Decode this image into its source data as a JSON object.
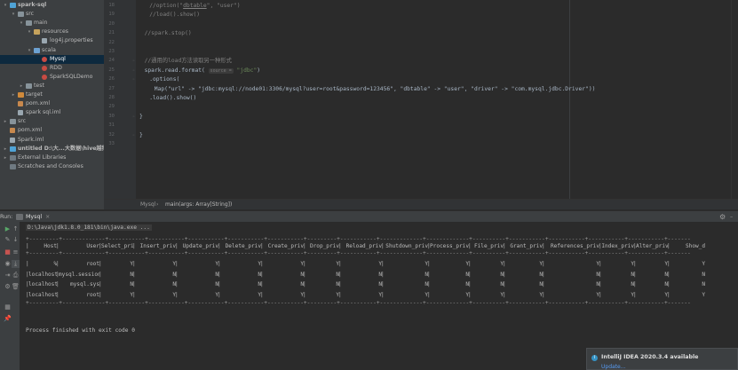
{
  "project_tree": [
    {
      "label": "spark-sql",
      "arrow": "▾",
      "icon": "module-folder-icon",
      "bold": true
    },
    {
      "label": "src",
      "arrow": "▾",
      "icon": "folder-icon"
    },
    {
      "label": "main",
      "arrow": "▾",
      "icon": "folder-icon"
    },
    {
      "label": "resources",
      "arrow": "▾",
      "icon": "resources-folder-icon"
    },
    {
      "label": "log4j.properties",
      "arrow": "",
      "icon": "properties-file-icon"
    },
    {
      "label": "scala",
      "arrow": "▾",
      "icon": "source-folder-icon"
    },
    {
      "label": "Mysql",
      "arrow": "",
      "icon": "scala-object-icon",
      "selected": true
    },
    {
      "label": "RDD",
      "arrow": "",
      "icon": "scala-object-icon"
    },
    {
      "label": "SparkSQLDemo",
      "arrow": "",
      "icon": "scala-object-icon"
    },
    {
      "label": "test",
      "arrow": "▸",
      "icon": "folder-icon"
    },
    {
      "label": "target",
      "arrow": "▸",
      "icon": "target-folder-icon"
    },
    {
      "label": "pom.xml",
      "arrow": "",
      "icon": "maven-file-icon"
    },
    {
      "label": "spark sql.iml",
      "arrow": "",
      "icon": "iml-file-icon"
    },
    {
      "label": "src",
      "arrow": "▸",
      "icon": "folder-icon"
    },
    {
      "label": "pom.xml",
      "arrow": "",
      "icon": "maven-file-icon"
    },
    {
      "label": "Spark.iml",
      "arrow": "",
      "icon": "iml-file-icon"
    },
    {
      "label": "untitled  D:\\大...大数据\\hive越狱书",
      "arrow": "▸",
      "icon": "module-folder-icon",
      "bold": true
    },
    {
      "label": "External Libraries",
      "arrow": "▸",
      "icon": "library-icon"
    },
    {
      "label": "Scratches and Consoles",
      "arrow": "",
      "icon": "scratches-icon"
    }
  ],
  "editor": {
    "line_numbers": [
      "18",
      "19",
      "20",
      "21",
      "22",
      "23",
      "24",
      "25",
      "26",
      "27",
      "28",
      "29",
      "30",
      "31",
      "32",
      "33"
    ],
    "lines": [
      {
        "indent": 2,
        "parts": [
          {
            "c": "cmt",
            "t": "//option(\""
          },
          {
            "c": "cmt",
            "t": "dbtable"
          },
          {
            "c": "cmt",
            "t": "\", \"user\")"
          }
        ]
      },
      {
        "indent": 2,
        "parts": [
          {
            "c": "cmt",
            "t": "//load().show()"
          }
        ]
      },
      {
        "indent": 0,
        "parts": []
      },
      {
        "indent": 1,
        "parts": [
          {
            "c": "cmt",
            "t": "//spark.stop()"
          }
        ]
      },
      {
        "indent": 0,
        "parts": []
      },
      {
        "indent": 0,
        "parts": []
      },
      {
        "indent": 1,
        "parts": [
          {
            "c": "cmt",
            "t": "//通用的load方法读取另一种形式"
          }
        ]
      },
      {
        "indent": 1,
        "parts": [
          {
            "c": "",
            "t": "spark.read.format( "
          },
          {
            "c": "hint",
            "t": "source ="
          },
          {
            "c": "str",
            "t": " \"jdbc\""
          },
          {
            "c": "",
            "t": ")"
          }
        ]
      },
      {
        "indent": 2,
        "parts": [
          {
            "c": "",
            "t": ".options("
          }
        ]
      },
      {
        "indent": 3,
        "parts": [
          {
            "c": "",
            "t": "Map(\"url\" -> \"jdbc:mysql://node01:3306/mysql?user=root&password=123456\", \"dbtable\" -> \"user\", \"driver\" -> \"com.mysql.jdbc.Driver\"))"
          }
        ]
      },
      {
        "indent": 2,
        "parts": [
          {
            "c": "",
            "t": ".load().show()"
          }
        ]
      },
      {
        "indent": 0,
        "parts": []
      },
      {
        "indent": 0,
        "parts": [
          {
            "c": "",
            "t": "}"
          }
        ]
      },
      {
        "indent": 0,
        "parts": []
      },
      {
        "indent": 0,
        "parts": [
          {
            "c": "",
            "t": "}"
          }
        ]
      },
      {
        "indent": 0,
        "parts": []
      }
    ]
  },
  "breadcrumb": {
    "item1": "Mysql",
    "sep": "›",
    "item2": "main(args: Array[String])"
  },
  "run_window": {
    "prefix": "Run:",
    "tab_label": "Mysql",
    "command": "D:\\Java\\jdk1.8.0_181\\bin\\java.exe ..."
  },
  "console": {
    "border": "+---------+-------------+-----------+-----------+-----------+-----------+-----------+---------+-----------+-------------+-------------+----------+-----------+-----------+-----------+-----------+-------",
    "headers": [
      "Host",
      "User",
      "Select_priv",
      "Insert_priv",
      "Update_priv",
      "Delete_priv",
      "Create_priv",
      "Drop_priv",
      "Reload_priv",
      "Shutdown_priv",
      "Process_priv",
      "File_priv",
      "Grant_priv",
      "References_priv",
      "Index_priv",
      "Alter_priv",
      "Show_d"
    ],
    "rows": [
      [
        "%",
        "root",
        "Y",
        "Y",
        "Y",
        "Y",
        "Y",
        "Y",
        "Y",
        "Y",
        "Y",
        "Y",
        "Y",
        "Y",
        "Y",
        "Y",
        "Y"
      ],
      [
        "localhost",
        "mysql.session",
        "N",
        "N",
        "N",
        "N",
        "N",
        "N",
        "N",
        "N",
        "N",
        "N",
        "N",
        "N",
        "N",
        "N",
        "N"
      ],
      [
        "localhost",
        "mysql.sys",
        "N",
        "N",
        "N",
        "N",
        "N",
        "N",
        "N",
        "N",
        "N",
        "N",
        "N",
        "N",
        "N",
        "N",
        "N"
      ],
      [
        "localhost",
        "root",
        "Y",
        "Y",
        "Y",
        "Y",
        "Y",
        "Y",
        "Y",
        "Y",
        "Y",
        "Y",
        "Y",
        "Y",
        "Y",
        "Y",
        "Y"
      ]
    ],
    "exit_message": "Process finished with exit code 0"
  },
  "notification": {
    "title": "IntelliJ IDEA 2020.3.4 available",
    "link": "Update..."
  }
}
